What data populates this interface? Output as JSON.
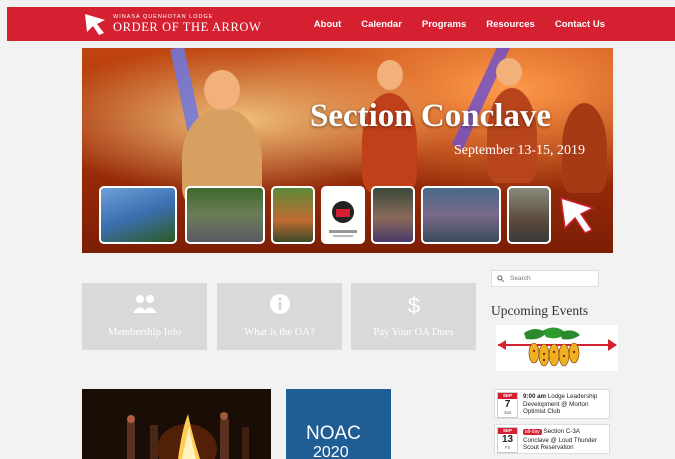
{
  "nav": {
    "logo_small": "WINASA QUENHOTAN LODGE",
    "logo_big": "ORDER OF THE ARROW",
    "items": [
      "About",
      "Calendar",
      "Programs",
      "Resources",
      "Contact Us"
    ]
  },
  "hero": {
    "title": "Section Conclave",
    "date": "September 13-15, 2019"
  },
  "cards": [
    {
      "label": "Membership Info",
      "icon": "people-icon"
    },
    {
      "label": "What is the OA?",
      "icon": "info-icon"
    },
    {
      "label": "Pay Your OA Dues",
      "icon": "dollar-icon"
    }
  ],
  "sidebar": {
    "search_placeholder": "Search",
    "upcoming_title": "Upcoming Events",
    "events": [
      {
        "month": "SEP",
        "day": "7",
        "weekday": "Sat",
        "time": "9:00 am",
        "title": "Lodge Leadership Development @ Morton Optimist Club"
      },
      {
        "month": "SEP",
        "day": "13",
        "weekday": "Fri",
        "badge": "all-day",
        "title": "Section C-3A Conclave @ Loud Thunder Scout Reservation"
      }
    ]
  },
  "posts": [
    {
      "noac": "NOAC",
      "year": "2020"
    }
  ],
  "colors": {
    "brand": "#d42030",
    "card": "#d9d9d9"
  }
}
